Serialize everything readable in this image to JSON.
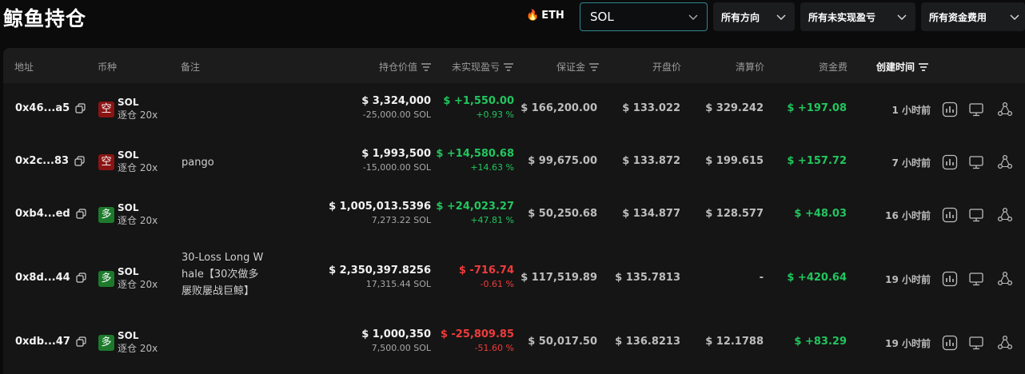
{
  "page_title": "鲸鱼持仓",
  "filters": {
    "eth_label": "ETH",
    "coin_select": "SOL",
    "direction": "所有方向",
    "pnl": "所有未实现盈亏",
    "funding": "所有资金费用"
  },
  "columns": {
    "address": "地址",
    "coin": "币种",
    "note": "备注",
    "value": "持仓价值",
    "pnl": "未实现盈亏",
    "margin": "保证金",
    "entry": "开盘价",
    "liq": "清算价",
    "funding": "资金费",
    "created": "创建时间"
  },
  "rows": [
    {
      "addr": "0x46...a5",
      "side": "空",
      "side_type": "short",
      "coin": "SOL",
      "lev": "逐仓 20x",
      "note": [
        "",
        "",
        ""
      ],
      "value": "$ 3,324,000",
      "size": "-25,000.00 SOL",
      "pnl": "$ +1,550.00",
      "pnl_pct": "+0.93 %",
      "pnl_pos": true,
      "margin": "$ 166,200.00",
      "entry": "$ 133.022",
      "liq": "$ 329.242",
      "funding": "$ +197.08",
      "time": "1 小时前"
    },
    {
      "addr": "0x2c...83",
      "side": "空",
      "side_type": "short",
      "coin": "SOL",
      "lev": "逐仓 20x",
      "note": [
        "pango",
        "",
        ""
      ],
      "value": "$ 1,993,500",
      "size": "-15,000.00 SOL",
      "pnl": "$ +14,580.68",
      "pnl_pct": "+14.63 %",
      "pnl_pos": true,
      "margin": "$ 99,675.00",
      "entry": "$ 133.872",
      "liq": "$ 199.615",
      "funding": "$ +157.72",
      "time": "7 小时前"
    },
    {
      "addr": "0xb4...ed",
      "side": "多",
      "side_type": "long",
      "coin": "SOL",
      "lev": "逐仓 20x",
      "note": [
        "",
        "",
        ""
      ],
      "value": "$ 1,005,013.5396",
      "size": "7,273.22 SOL",
      "pnl": "$ +24,023.27",
      "pnl_pct": "+47.81 %",
      "pnl_pos": true,
      "margin": "$ 50,250.68",
      "entry": "$ 134.877",
      "liq": "$ 128.577",
      "funding": "$ +48.03",
      "time": "16 小时前"
    },
    {
      "addr": "0x8d...44",
      "side": "多",
      "side_type": "long",
      "coin": "SOL",
      "lev": "逐仓 20x",
      "note": [
        "30-Loss Long W",
        "hale【30次做多",
        "屡败屡战巨鲸】"
      ],
      "value": "$ 2,350,397.8256",
      "size": "17,315.44 SOL",
      "pnl": "$ -716.74",
      "pnl_pct": "-0.61 %",
      "pnl_pos": false,
      "margin": "$ 117,519.89",
      "entry": "$ 135.7813",
      "liq": "-",
      "funding": "$ +420.64",
      "time": "19 小时前"
    },
    {
      "addr": "0xdb...47",
      "side": "多",
      "side_type": "long",
      "coin": "SOL",
      "lev": "逐仓 20x",
      "note": [
        "",
        "",
        ""
      ],
      "value": "$ 1,000,350",
      "size": "7,500.00 SOL",
      "pnl": "$ -25,809.85",
      "pnl_pct": "-51.60 %",
      "pnl_pos": false,
      "margin": "$ 50,017.50",
      "entry": "$ 136.8213",
      "liq": "$ 12.1788",
      "funding": "$ +83.29",
      "time": "19 小时前"
    }
  ],
  "icons": [
    "chart-icon",
    "monitor-icon",
    "share-icon",
    "copy-icon",
    "filter-icon",
    "chevron-down-icon",
    "flame-icon"
  ],
  "colors": {
    "positive": "#22c55e",
    "negative": "#ef3b3b",
    "short_badge": "#8a1414",
    "long_badge": "#1d7a2c",
    "select_border": "#2e8890"
  }
}
